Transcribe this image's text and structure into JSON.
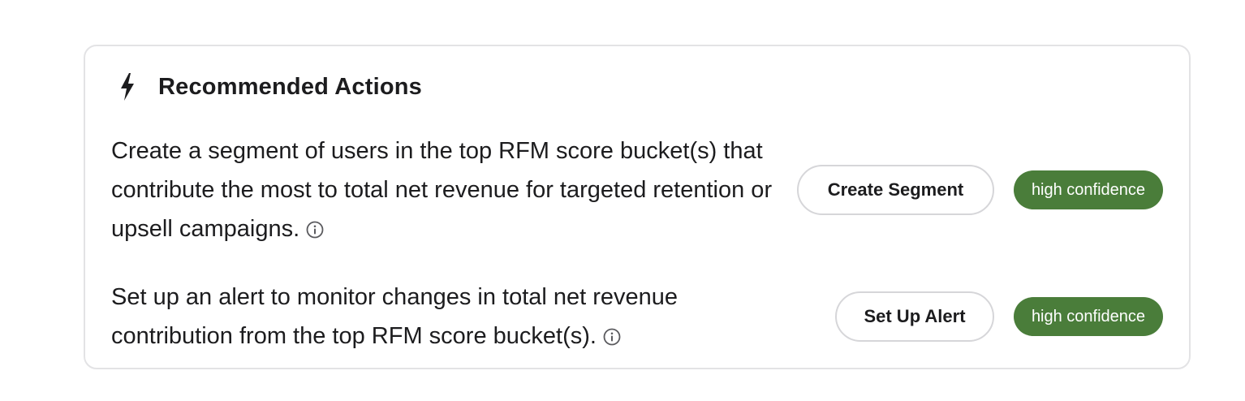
{
  "panel": {
    "title": "Recommended Actions",
    "title_icon": "lightning-bolt-icon"
  },
  "actions": [
    {
      "description": "Create a segment of users in the top RFM score bucket(s) that contribute the most to total net revenue for targeted retention or upsell campaigns.",
      "button_label": "Create Segment",
      "confidence": "high confidence",
      "info_icon": "info-icon"
    },
    {
      "description": "Set up an alert to monitor changes in total net revenue contribution from the top RFM score bucket(s).",
      "button_label": "Set Up Alert",
      "confidence": "high confidence",
      "info_icon": "info-icon"
    }
  ],
  "colors": {
    "badge_background": "#4a7d3a",
    "border": "#e3e3e5",
    "text": "#1c1c1e"
  }
}
